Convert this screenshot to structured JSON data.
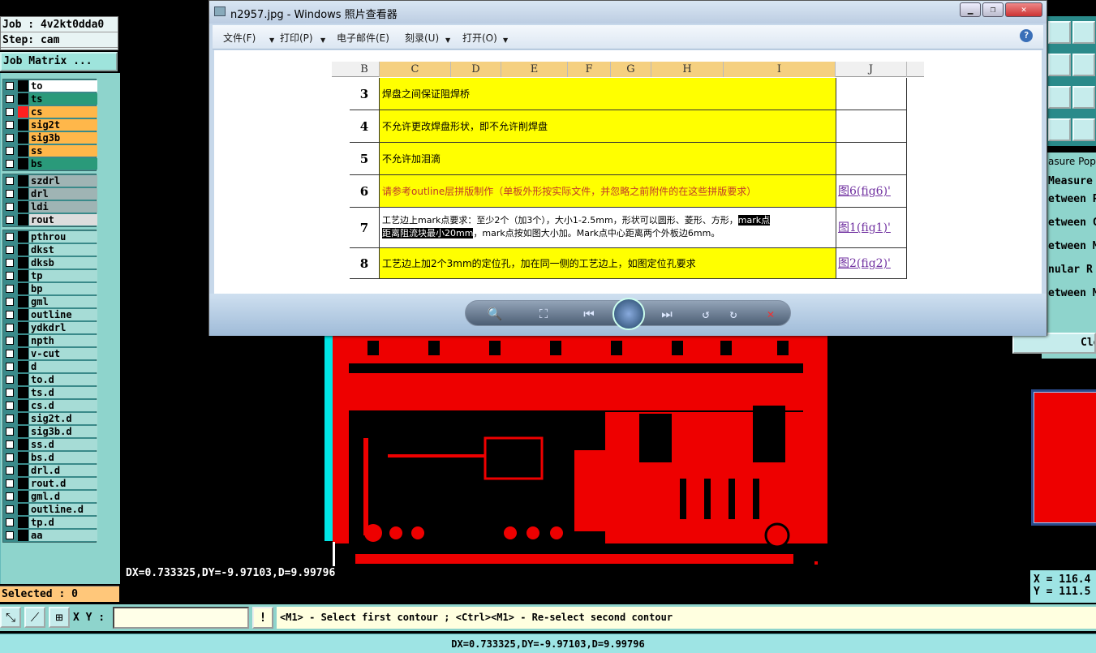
{
  "left_panel": {
    "job": "Job : 4v2kt0dda0",
    "step": "Step: cam",
    "job_matrix": "Job Matrix ...",
    "groups": [
      [
        {
          "name": "to",
          "color": "#ffffff"
        },
        {
          "name": "ts",
          "color": "#2a9a7a"
        },
        {
          "name": "cs",
          "color": "#ffb74a",
          "active": true
        },
        {
          "name": "sig2t",
          "color": "#ffb74a"
        },
        {
          "name": "sig3b",
          "color": "#ffb74a"
        },
        {
          "name": "ss",
          "color": "#ffb74a"
        },
        {
          "name": "bs",
          "color": "#2a9a7a"
        }
      ],
      [
        {
          "name": "szdrl",
          "color": "#9fb4b4"
        },
        {
          "name": "drl",
          "color": "#9fb4b4"
        },
        {
          "name": "ldi",
          "color": "#9fb4b4"
        },
        {
          "name": "rout",
          "color": "#dddddd"
        }
      ],
      [
        {
          "name": "pthrou"
        },
        {
          "name": "dkst"
        },
        {
          "name": "dksb"
        },
        {
          "name": "tp"
        },
        {
          "name": "bp"
        },
        {
          "name": "gml"
        },
        {
          "name": "outline"
        },
        {
          "name": "ydkdrl"
        },
        {
          "name": "npth"
        },
        {
          "name": "v-cut"
        },
        {
          "name": "d"
        },
        {
          "name": "to.d"
        },
        {
          "name": "ts.d"
        },
        {
          "name": "cs.d"
        },
        {
          "name": "sig2t.d"
        },
        {
          "name": "sig3b.d"
        },
        {
          "name": "ss.d"
        },
        {
          "name": "bs.d"
        },
        {
          "name": "drl.d"
        },
        {
          "name": "rout.d"
        },
        {
          "name": "gml.d"
        },
        {
          "name": "outline.d"
        },
        {
          "name": "tp.d"
        },
        {
          "name": "aa"
        }
      ]
    ],
    "selected": "Selected : 0"
  },
  "canvas": {
    "readout": "DX=0.733325,DY=-9.97103,D=9.99796"
  },
  "command_bar": {
    "xy_label": "X Y :",
    "xy_value": "",
    "warn": "!",
    "hint": "<M1> - Select first contour ; <Ctrl><M1> - Re-select second contour"
  },
  "status_bar": "DX=0.733325,DY=-9.97103,D=9.99796",
  "measure_panel": {
    "title": "asure Popu",
    "items": [
      "Measure",
      "etween P",
      "etween C",
      "etween M",
      "nular R",
      "etween M"
    ],
    "close": "Clos",
    "x": "X = 116.4",
    "y": "Y = 111.5"
  },
  "viewer": {
    "title": "n2957.jpg - Windows 照片查看器",
    "menu": [
      "文件(F)",
      "打印(P)",
      "电子邮件(E)",
      "刻录(U)",
      "打开(O)"
    ],
    "help": "?",
    "sheet": {
      "columns": [
        "B",
        "C",
        "D",
        "E",
        "F",
        "G",
        "H",
        "I",
        "J"
      ],
      "rows": [
        {
          "num": "3",
          "text": "焊盘之间保证阻焊桥",
          "link": ""
        },
        {
          "num": "4",
          "text": "不允许更改焊盘形状，即不允许削焊盘",
          "link": ""
        },
        {
          "num": "5",
          "text": "不允许加泪滴",
          "link": ""
        },
        {
          "num": "6",
          "text": "请参考outline层拼版制作（单板外形按实际文件，并忽略之前附件的在这些拼版要求）",
          "link": "图6(fig6)'"
        },
        {
          "num": "7",
          "line1a": "工艺边上mark点要求：至少2个（加3个），大小1-2.5mm，形状可以圆形、菱形、方形，",
          "line1b": "mark点",
          "line2a": "距离阻流块最小20mm",
          "line2b": "，mark点按如图大小加。Mark点中心距离两个外板边6mm。",
          "link": "图1(fig1)'"
        },
        {
          "num": "8",
          "text": "工艺边上加2个3mm的定位孔，加在同一侧的工艺边上，如图定位孔要求",
          "link": "图2(fig2)'"
        }
      ]
    }
  }
}
